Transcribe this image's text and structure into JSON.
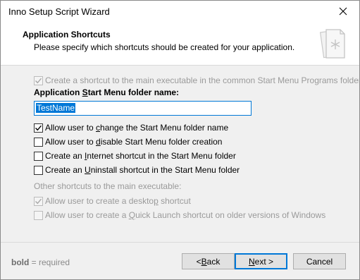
{
  "window": {
    "title": "Inno Setup Script Wizard"
  },
  "header": {
    "title": "Application Shortcuts",
    "subtitle": "Please specify which shortcuts should be created for your application."
  },
  "main_shortcut": {
    "checked": true,
    "disabled": true,
    "label": "Create a shortcut to the main executable in the common Start Menu Programs folder"
  },
  "folder": {
    "label_pre": "Application ",
    "label_u": "S",
    "label_post": "tart Menu folder name:",
    "value": "TestName"
  },
  "options": [
    {
      "pre": "Allow user to ",
      "u": "c",
      "post": "hange the Start Menu folder name",
      "checked": true
    },
    {
      "pre": "Allow user to ",
      "u": "d",
      "post": "isable Start Menu folder creation",
      "checked": false
    },
    {
      "pre": "Create an ",
      "u": "I",
      "post": "nternet shortcut in the Start Menu folder",
      "checked": false
    },
    {
      "pre": "Create an ",
      "u": "U",
      "post": "ninstall shortcut in the Start Menu folder",
      "checked": false
    }
  ],
  "other": {
    "label": "Other shortcuts to the main executable:",
    "items": [
      {
        "pre": "Allow user to create a deskto",
        "u": "p",
        "post": " shortcut",
        "checked": true
      },
      {
        "pre": "Allow user to create a ",
        "u": "Q",
        "post": "uick Launch shortcut on older versions of Windows",
        "checked": false
      }
    ]
  },
  "footer": {
    "required_bold": "bold",
    "required_text": " = required",
    "back_pre": "< ",
    "back_u": "B",
    "back_post": "ack",
    "next_u": "N",
    "next_post": "ext >",
    "cancel": "Cancel"
  },
  "colors": {
    "accent": "#0078d7",
    "disabled_text": "#9a9a9a",
    "panel": "#f0f0f0"
  },
  "icons": {
    "close": "close-icon",
    "header": "document-page-icon",
    "check": "checkmark-icon"
  }
}
